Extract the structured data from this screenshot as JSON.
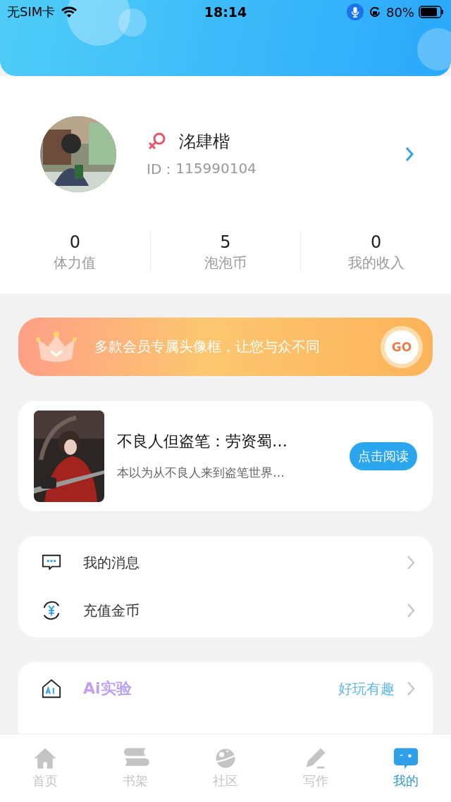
{
  "status_bar": {
    "carrier": "无SIM卡",
    "time": "18:14",
    "battery": "80%"
  },
  "profile": {
    "name": "洺肆楷",
    "id_label": "ID：",
    "id": "115990104"
  },
  "stats": [
    {
      "value": "0",
      "label": "体力值"
    },
    {
      "value": "5",
      "label": "泡泡币"
    },
    {
      "value": "0",
      "label": "我的收入"
    }
  ],
  "vip_banner": {
    "text": "多款会员专属头像框，让您与众不同",
    "button": "GO"
  },
  "book": {
    "title": "不良人但盗笔：劳资蜀…",
    "summary": "本以为从不良人来到盗笔世界…",
    "button": "点击阅读"
  },
  "menu_groups": [
    [
      {
        "kind": "message",
        "label": "我的消息"
      },
      {
        "kind": "coin",
        "label": "充值金币"
      }
    ],
    [
      {
        "kind": "ai",
        "label": "Ai实验",
        "hint": "好玩有趣"
      }
    ]
  ],
  "tabs": [
    {
      "kind": "home",
      "label": "首页",
      "selected": false
    },
    {
      "kind": "shelf",
      "label": "书架",
      "selected": false
    },
    {
      "kind": "planet",
      "label": "社区",
      "selected": false
    },
    {
      "kind": "pen",
      "label": "写作",
      "selected": false
    },
    {
      "kind": "me",
      "label": "我的",
      "selected": true
    }
  ]
}
